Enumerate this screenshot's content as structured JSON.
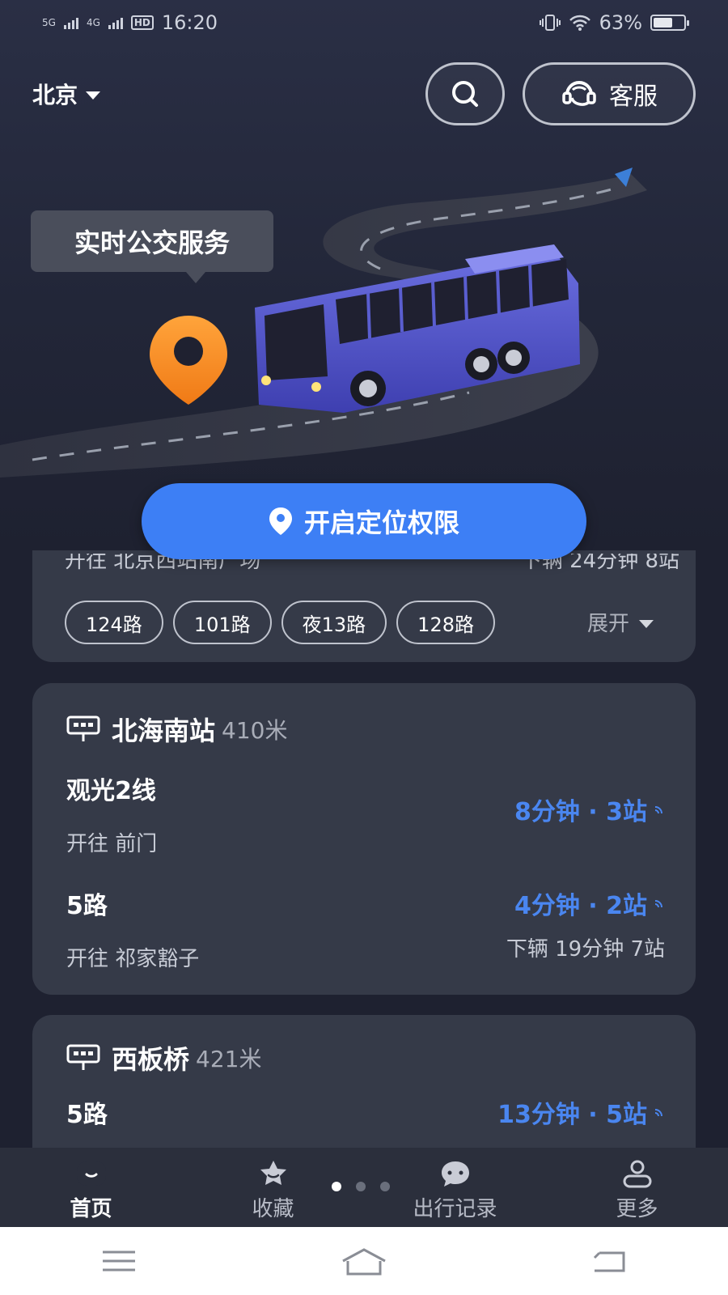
{
  "status_bar": {
    "network1": "5G",
    "network2": "4G",
    "hd": "HD",
    "time": "16:20",
    "battery": "63%",
    "battery_level": 0.63
  },
  "header": {
    "city": "北京",
    "service_label": "客服"
  },
  "hero": {
    "bubble_text": "实时公交服务"
  },
  "locate_button": {
    "label": "开启定位权限"
  },
  "card_partial": {
    "direction_text": "开往  北京西站南广场",
    "next_text": "下辆  24分钟  8站",
    "routes": [
      "124路",
      "101路",
      "夜13路",
      "128路"
    ],
    "expand_label": "展开"
  },
  "stops": [
    {
      "name": "北海南站",
      "distance": "410米",
      "lines": [
        {
          "name": "观光2线",
          "direction": "开往  前门",
          "eta": "8分钟 · 3站",
          "next": ""
        },
        {
          "name": "5路",
          "direction": "开往  祁家豁子",
          "eta": "4分钟 · 2站",
          "next": "下辆  19分钟  7站"
        }
      ]
    },
    {
      "name": "西板桥",
      "distance": "421米",
      "lines": [
        {
          "name": "5路",
          "direction": "",
          "eta": "13分钟 · 5站",
          "next": ""
        }
      ]
    }
  ],
  "bottom_nav": {
    "items": [
      {
        "label": "首页",
        "icon": "home-icon",
        "active": true
      },
      {
        "label": "收藏",
        "icon": "star-icon",
        "active": false
      },
      {
        "label": "出行记录",
        "icon": "chat-icon",
        "active": false
      },
      {
        "label": "更多",
        "icon": "person-icon",
        "active": false
      }
    ]
  },
  "colors": {
    "accent": "#3d7ff5",
    "eta": "#4a86f0",
    "card": "#353a48",
    "background": "#1e2130"
  }
}
